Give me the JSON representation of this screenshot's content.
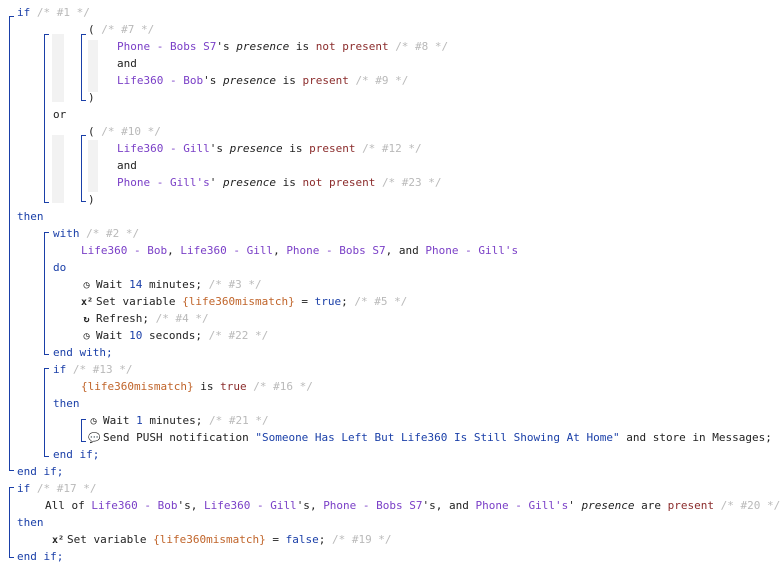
{
  "kw": {
    "if": "if",
    "then": "then",
    "end_if": "end if;",
    "end_if_plain": "end if;",
    "with": "with",
    "do": "do",
    "end_with": "end with;",
    "or": "or",
    "and": "and",
    "open": "(",
    "close": ")"
  },
  "comments": {
    "c1": "/* #1 */",
    "c7": "/* #7 */",
    "c8": "/* #8 */",
    "c9": "/* #9 */",
    "c10": "/* #10 */",
    "c12": "/* #12 */",
    "c23": "/* #23 */",
    "c2": "/* #2 */",
    "c3": "/* #3 */",
    "c5": "/* #5 */",
    "c4": "/* #4 */",
    "c22": "/* #22 */",
    "c13": "/* #13 */",
    "c16": "/* #16 */",
    "c21": "/* #21 */",
    "c17": "/* #17 */",
    "c20": "/* #20 */",
    "c19": "/* #19 */"
  },
  "devices": {
    "phone_bob": "Phone - Bobs S7",
    "life_bob": "Life360 - Bob",
    "life_gill": "Life360 - Gill",
    "phone_gill": "Phone - Gill's"
  },
  "words": {
    "apos_s": "'s",
    "apos": "'",
    "presence": "presence",
    "is": "is",
    "not": "not",
    "present": "present",
    "comma": ",",
    "and_sep": ", and",
    "is_true": "is",
    "true": "true",
    "false": "false",
    "are": "are",
    "all_of": "All of",
    "eq": "=",
    "semi": ";"
  },
  "actions": {
    "wait14": "Wait",
    "wait14_num": "14",
    "wait14_unit": "minutes;",
    "setvar": "Set variable",
    "var_name": "{life360mismatch}",
    "refresh": "Refresh;",
    "wait10": "Wait",
    "wait10_num": "10",
    "wait10_unit": "seconds;",
    "wait1": "Wait",
    "wait1_num": "1",
    "wait1_unit": "minutes;",
    "push": "Send PUSH notification",
    "push_msg": "\"Someone Has Left But Life360 Is Still Showing At Home\"",
    "push_tail": "and store in Messages;"
  },
  "icons": {
    "clock": "clock-icon",
    "var": "variable-icon",
    "refresh": "refresh-icon",
    "message": "message-icon"
  },
  "colors": {
    "keyword": "#1a3fa8",
    "comment": "#b9b9b9",
    "device": "#7a3fc7",
    "value": "#8b2c2c",
    "variable": "#c0642a"
  }
}
